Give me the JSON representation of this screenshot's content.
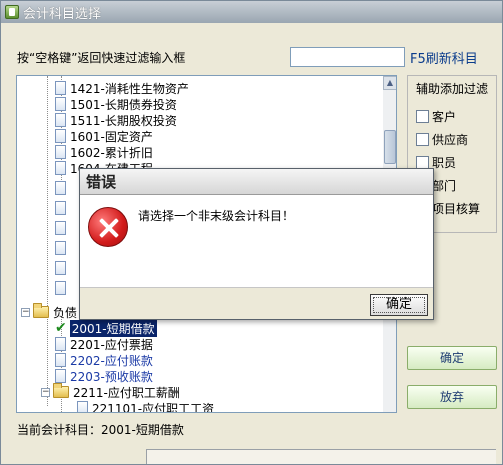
{
  "window": {
    "title": "会计科目选择"
  },
  "filter": {
    "label": "按“空格键”返回快速过滤输入框",
    "input_value": "",
    "refresh_label": "F5刷新科目"
  },
  "tree": {
    "items": [
      {
        "code_label": "1421-消耗性生物资产"
      },
      {
        "code_label": "1501-长期债券投资"
      },
      {
        "code_label": "1511-长期股权投资"
      },
      {
        "code_label": "1601-固定资产"
      },
      {
        "code_label": "1602-累计折旧"
      },
      {
        "code_label": "1604-在建工程"
      }
    ],
    "group_liabilities": "负债",
    "selected_item": "2001-短期借款",
    "items_after": [
      {
        "code_label": "2201-应付票据"
      },
      {
        "code_label": "2202-应付账款"
      },
      {
        "code_label": "2203-预收账款"
      }
    ],
    "group_2211": "2211-应付职工薪酬",
    "child_221101": "221101-应付职工工资"
  },
  "assist_panel": {
    "title": "辅助添加过滤",
    "options": [
      "客户",
      "供应商",
      "职员",
      "部门",
      "项目核算"
    ]
  },
  "buttons": {
    "confirm": "确定",
    "cancel": "放弃"
  },
  "status": {
    "current_label": "当前会计科目：2001-短期借款"
  },
  "dialog": {
    "title": "错误",
    "message": "请选择一个非末级会计科目！",
    "ok_label": "确定"
  }
}
